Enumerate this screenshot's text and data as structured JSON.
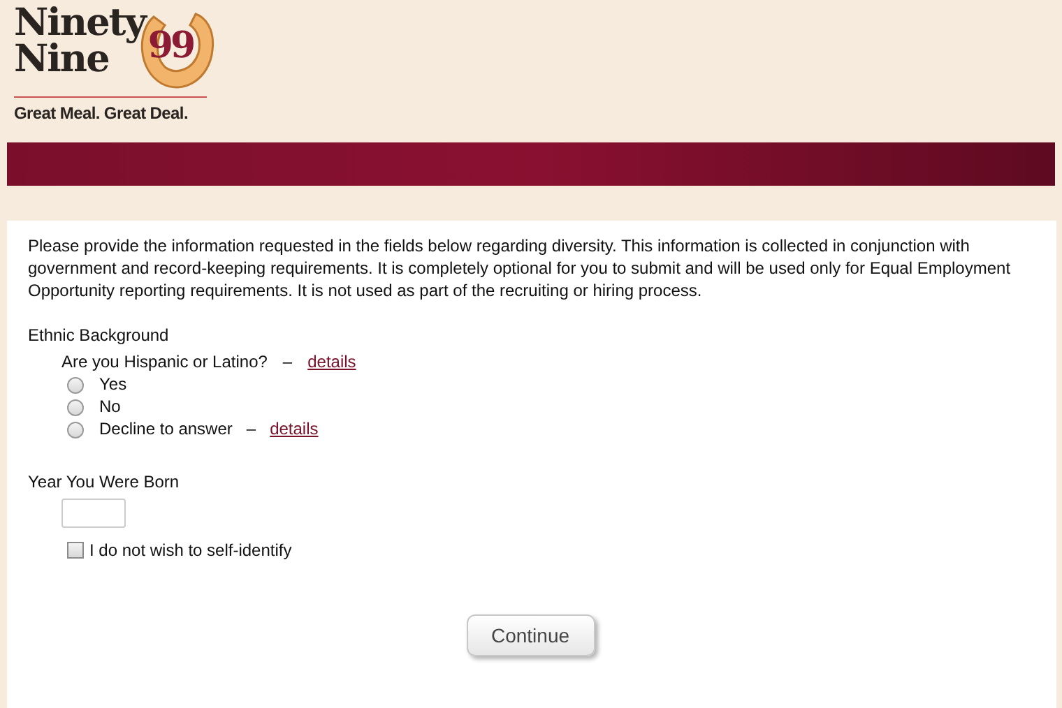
{
  "logo": {
    "line_1": "Ninety",
    "line_2": "Nine",
    "number": "99",
    "tagline": "Great Meal. Great Deal."
  },
  "intro": "Please provide the information requested in the fields below regarding diversity. This information is collected in conjunction with government and record-keeping requirements. It is completely optional for you to submit and will be used only for Equal Employment Opportunity reporting requirements. It is not used as part of the recruiting or hiring process.",
  "ethnic": {
    "heading": "Ethnic Background",
    "question": "Are you Hispanic or Latino?",
    "dash": "–",
    "link": "details",
    "options": [
      {
        "label": "Yes",
        "selected": false
      },
      {
        "label": "No",
        "selected": false
      },
      {
        "label": "Decline to answer",
        "selected": false,
        "dash": "–",
        "link": "details"
      }
    ]
  },
  "birth_year": {
    "label": "Year You Were Born",
    "opt_out": {
      "label": "I do not wish to self-identify",
      "checked": false
    }
  },
  "continue_button": "Continue"
}
